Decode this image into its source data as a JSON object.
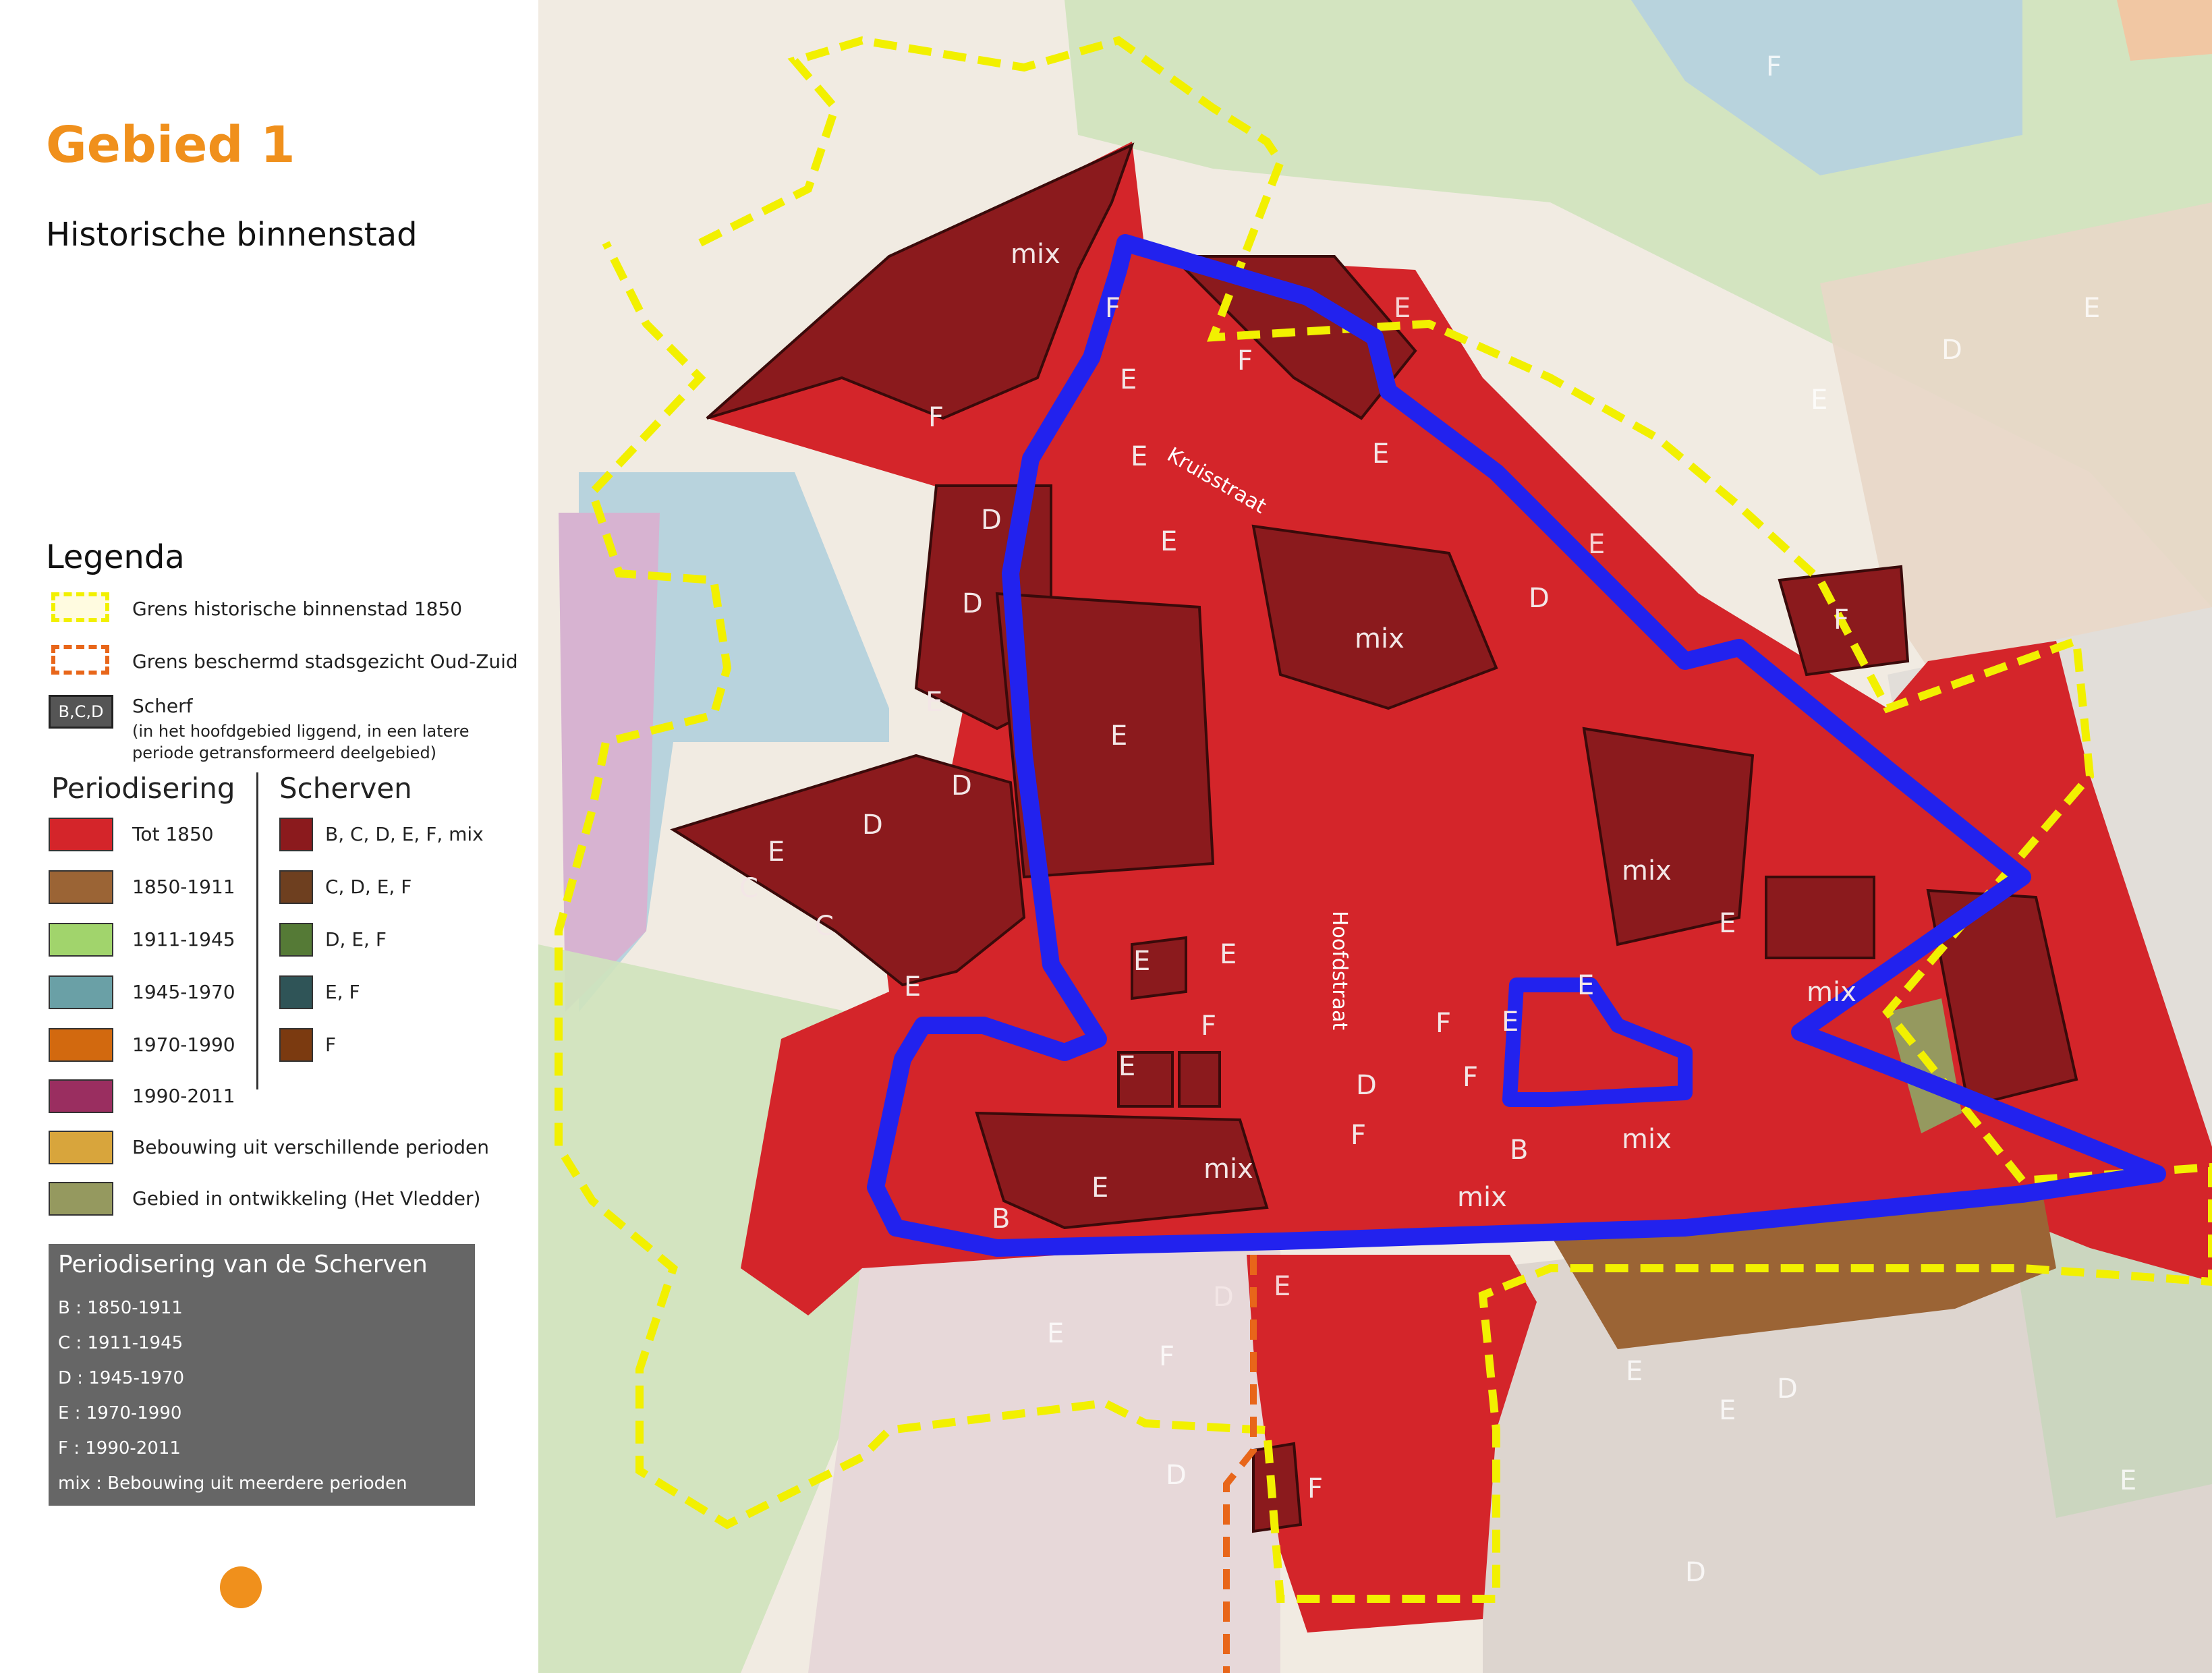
{
  "title": "Gebied 1",
  "subtitle": "Historische binnenstad",
  "legend": {
    "heading": "Legenda",
    "border_1850": "Grens historische binnenstad 1850",
    "border_oudzuid": "Grens beschermd stadsgezicht Oud-Zuid",
    "scherf_box": "B,C,D",
    "scherf_label": "Scherf",
    "scherf_note": "(in het hoofdgebied liggend, in een latere periode getransformeerd deelgebied)",
    "periodisering_heading": "Periodisering",
    "scherven_heading": "Scherven",
    "periods": [
      {
        "label": "Tot 1850",
        "color": "#d4252a"
      },
      {
        "label": "1850-1911",
        "color": "#9b6435"
      },
      {
        "label": "1911-1945",
        "color": "#a1d46c"
      },
      {
        "label": "1945-1970",
        "color": "#6aa0a6"
      },
      {
        "label": "1970-1990",
        "color": "#d2690f"
      },
      {
        "label": "1990-2011",
        "color": "#9a2e60"
      },
      {
        "label": "Bebouwing uit verschillende perioden",
        "color": "#d8a53c"
      },
      {
        "label": "Gebied in ontwikkeling (Het Vledder)",
        "color": "#95995f"
      }
    ],
    "scherven": [
      {
        "label": "B, C, D, E, F, mix",
        "color": "#8b1a1d"
      },
      {
        "label": "C, D, E, F",
        "color": "#6e3f1f"
      },
      {
        "label": "D, E, F",
        "color": "#557a36"
      },
      {
        "label": "E, F",
        "color": "#2f5457"
      },
      {
        "label": "F",
        "color": "#7b3a10"
      }
    ]
  },
  "period_box": {
    "title": "Periodisering van de Scherven",
    "lines": [
      "B    :  1850-1911",
      "C    :  1911-1945",
      "D    :  1945-1970",
      "E    :  1970-1990",
      "F    :  1990-2011",
      "mix :  Bebouwing uit meerdere perioden"
    ]
  },
  "map": {
    "streets": [
      "Kruisstraat",
      "Hoofdstraat"
    ],
    "labels": [
      "mix",
      "F",
      "F",
      "E",
      "F",
      "E",
      "E",
      "D",
      "D",
      "E",
      "mix",
      "D",
      "E",
      "E",
      "D",
      "D",
      "E",
      "C",
      "C",
      "E",
      "mix",
      "E",
      "E",
      "E",
      "F",
      "E",
      "mix",
      "E",
      "F",
      "E",
      "F",
      "D",
      "F",
      "B",
      "mix",
      "mix",
      "E",
      "mix",
      "B",
      "D",
      "E",
      "E",
      "F",
      "D",
      "F",
      "E",
      "E",
      "D",
      "E",
      "D",
      "F",
      "E",
      "D",
      "E",
      "E",
      "E",
      "F"
    ],
    "colors": {
      "outline": "#2222ee",
      "old_town": "#d4252a",
      "scherf": "#8b1a1d",
      "green": "#cfe3bd",
      "blue": "#b6cfd8"
    }
  }
}
